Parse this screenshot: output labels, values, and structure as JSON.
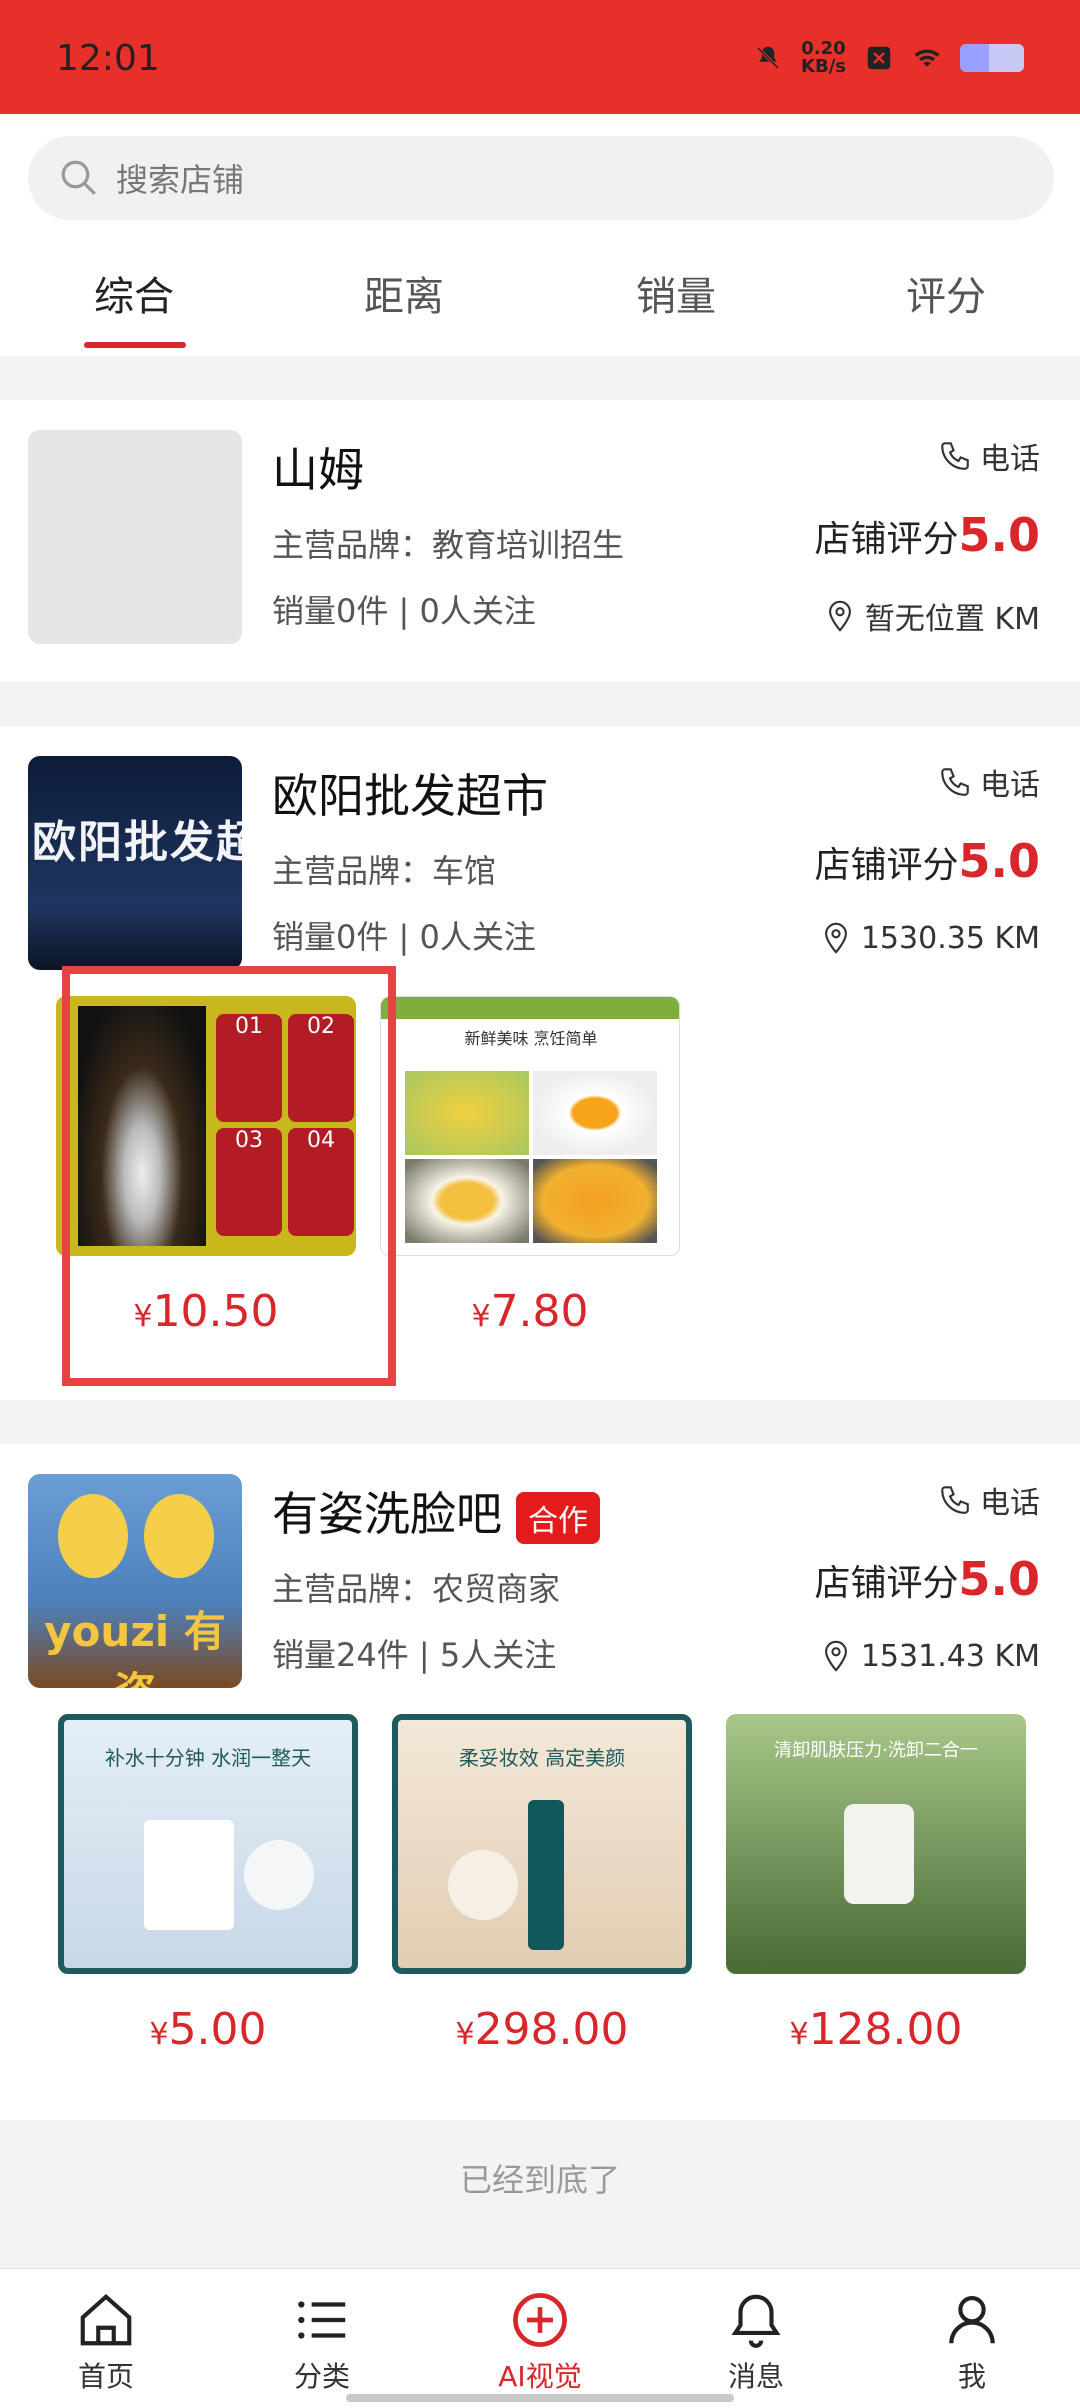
{
  "status": {
    "time": "12:01",
    "speed_value": "0.20",
    "speed_unit": "KB/s",
    "icons": [
      "mute-bell-icon",
      "close-badge-icon",
      "wifi-icon",
      "battery-icon"
    ]
  },
  "search": {
    "placeholder": "搜索店铺"
  },
  "tabs": [
    "综合",
    "距离",
    "销量",
    "评分"
  ],
  "active_tab": "综合",
  "stores": [
    {
      "name": "山姆",
      "tag": "",
      "brand": "主营品牌：教育培训招生",
      "stats": "销量0件 | 0人关注",
      "phone": "电话",
      "rating_label": "店铺评分",
      "rating": "5.0",
      "distance": "暂无位置 KM",
      "products": []
    },
    {
      "name": "欧阳批发超市",
      "tag": "",
      "avatar_text": "欧阳批发超市",
      "brand": "主营品牌：车馆",
      "stats": "销量0件 | 0人关注",
      "phone": "电话",
      "rating_label": "店铺评分",
      "rating": "5.0",
      "distance": "1530.35 KM",
      "products": [
        {
          "price": "10.50",
          "img_labels": [
            "01",
            "02",
            "03",
            "04"
          ]
        },
        {
          "price": "7.80",
          "img_header": "新鲜美味 烹饪简单"
        }
      ]
    },
    {
      "name": "有姿洗脸吧",
      "tag": "合作",
      "avatar_text": "youzi 有姿",
      "brand": "主营品牌：农贸商家",
      "stats": "销量24件 | 5人关注",
      "phone": "电话",
      "rating_label": "店铺评分",
      "rating": "5.0",
      "distance": "1531.43 KM",
      "products": [
        {
          "price": "5.00",
          "img_header": "补水十分钟 水润一整天"
        },
        {
          "price": "298.00",
          "img_header": "柔妥妆效 高定美颜"
        },
        {
          "price": "128.00",
          "img_header": "清卸肌肤压力·洗卸二合一"
        }
      ]
    }
  ],
  "currency": "¥",
  "end_text": "已经到底了",
  "tabbar": [
    {
      "label": "首页",
      "icon": "home-icon"
    },
    {
      "label": "分类",
      "icon": "list-icon"
    },
    {
      "label": "AI视觉",
      "icon": "plus-circle-icon"
    },
    {
      "label": "消息",
      "icon": "bell-icon"
    },
    {
      "label": "我",
      "icon": "person-icon"
    }
  ],
  "colors": {
    "accent": "#e8302a",
    "price": "#d8262a",
    "highlight_border": "#e84343"
  }
}
